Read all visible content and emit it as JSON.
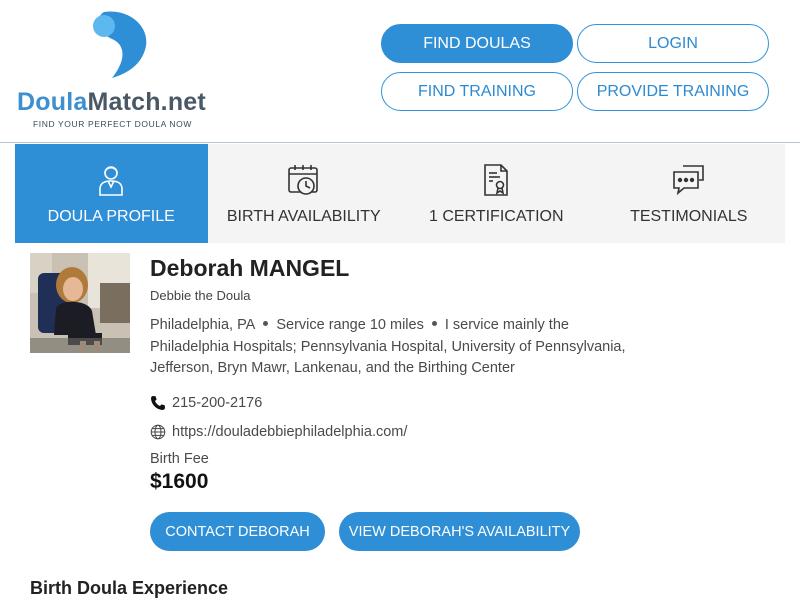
{
  "brand": {
    "name_part1": "Doula",
    "name_part2": "Match.net",
    "tagline": "FIND YOUR PERFECT DOULA NOW",
    "color_primary": "#2e8fd6",
    "color_light": "#5cb8ee"
  },
  "nav": {
    "find_doulas": "FIND DOULAS",
    "login": "LOGIN",
    "find_training": "FIND TRAINING",
    "provide_training": "PROVIDE TRAINING"
  },
  "tabs": [
    {
      "label": "DOULA PROFILE",
      "icon": "person-icon",
      "active": true
    },
    {
      "label": "BIRTH AVAILABILITY",
      "icon": "calendar-clock-icon",
      "active": false
    },
    {
      "label": "1 CERTIFICATION",
      "icon": "certificate-icon",
      "active": false
    },
    {
      "label": "TESTIMONIALS",
      "icon": "chat-bubbles-icon",
      "active": false
    }
  ],
  "profile": {
    "name": "Deborah MANGEL",
    "nickname": "Debbie the Doula",
    "location": "Philadelphia, PA",
    "service_range": "Service range 10 miles",
    "service_note": "I service mainly the Philadelphia Hospitals; Pennsylvania Hospital, University of Pennsylvania, Jefferson, Bryn Mawr, Lankenau, and the Birthing Center",
    "phone": "215-200-2176",
    "website": "https://douladebbiephiladelphia.com/",
    "fee_label": "Birth Fee",
    "fee_value": "$1600"
  },
  "actions": {
    "contact": "CONTACT DEBORAH",
    "availability": "VIEW DEBORAH'S AVAILABILITY"
  },
  "sections": {
    "experience_heading": "Birth Doula Experience"
  }
}
